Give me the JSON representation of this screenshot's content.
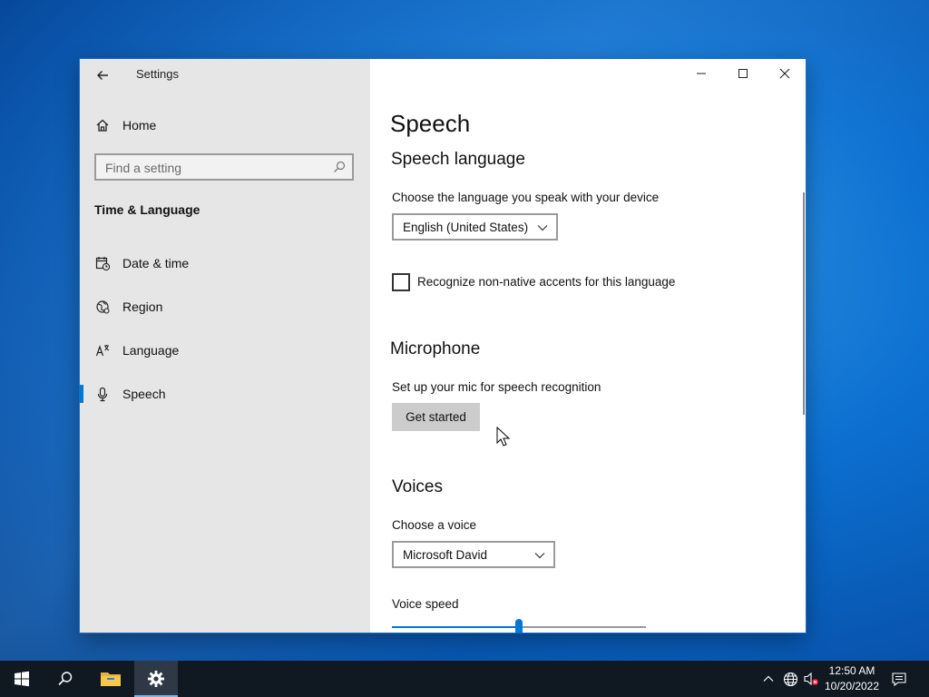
{
  "window": {
    "title": "Settings",
    "controls": {
      "minimize": "minimize",
      "maximize": "maximize",
      "close": "close"
    }
  },
  "sidebar": {
    "home": "Home",
    "search": {
      "placeholder": "Find a setting",
      "value": ""
    },
    "category": "Time & Language",
    "items": [
      {
        "label": "Date & time",
        "icon": "calendar-clock-icon"
      },
      {
        "label": "Region",
        "icon": "globe-icon"
      },
      {
        "label": "Language",
        "icon": "language-icon"
      },
      {
        "label": "Speech",
        "icon": "microphone-icon",
        "selected": true
      }
    ]
  },
  "main": {
    "title": "Speech",
    "speech_language": {
      "heading": "Speech language",
      "description": "Choose the language you speak with your device",
      "selected": "English (United States)",
      "checkbox_label": "Recognize non-native accents for this language",
      "checkbox_checked": false
    },
    "microphone": {
      "heading": "Microphone",
      "description": "Set up your mic for speech recognition",
      "button": "Get started"
    },
    "voices": {
      "heading": "Voices",
      "choose_label": "Choose a voice",
      "selected": "Microsoft David",
      "speed_label": "Voice speed",
      "speed_fraction": 0.5
    }
  },
  "taskbar": {
    "time": "12:50 AM",
    "date": "10/20/2022"
  },
  "colors": {
    "accent": "#0078d7",
    "sidebar_bg": "#e6e6e6",
    "taskbar_bg": "#101822"
  }
}
